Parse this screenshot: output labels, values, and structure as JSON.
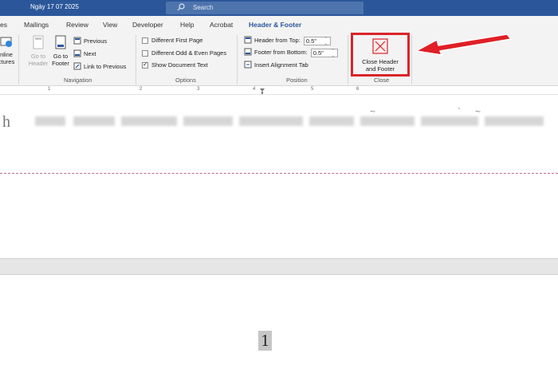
{
  "titlebar": {
    "doc_title": "Ngày 17 07 2025",
    "search_placeholder": "Search",
    "search_icon": "search-icon"
  },
  "tabs": [
    {
      "label": "es",
      "active": false
    },
    {
      "label": "Mailings",
      "active": false
    },
    {
      "label": "Review",
      "active": false
    },
    {
      "label": "View",
      "active": false
    },
    {
      "label": "Developer",
      "active": false
    },
    {
      "label": "Help",
      "active": false
    },
    {
      "label": "Acrobat",
      "active": false
    },
    {
      "label": "Header & Footer",
      "active": true
    }
  ],
  "ribbon": {
    "insert": {
      "online_pictures_line1": "nline",
      "online_pictures_line2": "ctures"
    },
    "navigation": {
      "go_to_header_line1": "Go to",
      "go_to_header_line2": "Header",
      "go_to_footer_line1": "Go to",
      "go_to_footer_line2": "Footer",
      "previous": "Previous",
      "next": "Next",
      "link_to_previous": "Link to Previous",
      "label": "Navigation"
    },
    "options": {
      "different_first_page": "Different First Page",
      "different_odd_even": "Different Odd & Even Pages",
      "show_document_text": "Show Document Text",
      "different_first_page_checked": false,
      "different_odd_even_checked": false,
      "show_document_text_checked": true,
      "label": "Options"
    },
    "position": {
      "header_from_top_label": "Header from Top:",
      "header_from_top_value": "0.5\"",
      "footer_from_bottom_label": "Footer from Bottom:",
      "footer_from_bottom_value": "0.5\"",
      "insert_alignment_tab": "Insert Alignment Tab",
      "label": "Position"
    },
    "close": {
      "button_line1": "Close Header",
      "button_line2": "and Footer",
      "label": "Close"
    }
  },
  "ruler": {
    "numbers": [
      "1",
      "2",
      "3",
      "4",
      "5",
      "6"
    ]
  },
  "document": {
    "first_char": "h",
    "page_number": "1"
  },
  "colors": {
    "brand_blue": "#2b579a",
    "highlight_red": "#d9252b",
    "header_boundary": "#c26b8d"
  }
}
